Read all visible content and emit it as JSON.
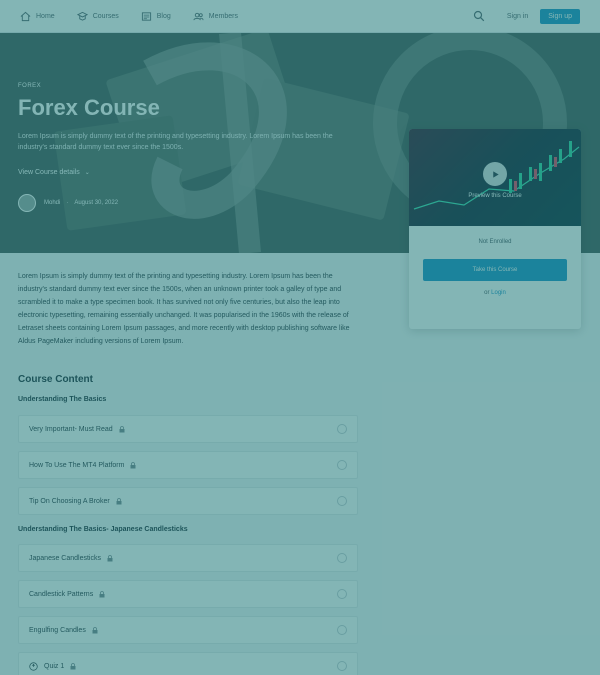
{
  "nav": {
    "items": [
      {
        "label": "Home",
        "icon": "home-icon"
      },
      {
        "label": "Courses",
        "icon": "courses-icon"
      },
      {
        "label": "Blog",
        "icon": "blog-icon"
      },
      {
        "label": "Members",
        "icon": "members-icon"
      }
    ],
    "signin": "Sign in",
    "signup": "Sign up"
  },
  "hero": {
    "tag": "FOREX",
    "title": "Forex Course",
    "description": "Lorem Ipsum is simply dummy text of the printing and typesetting industry. Lorem Ipsum has been the industry's standard dummy text ever since the 1500s.",
    "details_link": "View Course details",
    "author": "Mohdi",
    "date": "August 30, 2022"
  },
  "card": {
    "preview_label": "Preview this Course",
    "status": "Not Enrolled",
    "cta": "Take this Course",
    "or_text": "or",
    "login": "Login"
  },
  "about": "Lorem Ipsum is simply dummy text of the printing and typesetting industry. Lorem Ipsum has been the industry's standard dummy text ever since the 1500s, when an unknown printer took a galley of type and scrambled it to make a type specimen book. It has survived not only five centuries, but also the leap into electronic typesetting, remaining essentially unchanged. It was popularised in the 1960s with the release of Letraset sheets containing Lorem Ipsum passages, and more recently with desktop publishing software like Aldus PageMaker including versions of Lorem Ipsum.",
  "course_content": {
    "title": "Course Content",
    "topics": [
      {
        "title": "Understanding The Basics",
        "lessons": [
          "Very Important- Must Read",
          "How To Use The MT4 Platform",
          "Tip On Choosing A Broker"
        ]
      },
      {
        "title": "Understanding The Basics- Japanese Candlesticks",
        "lessons": [
          "Japanese Candlesticks",
          "Candlestick Patterns",
          "Engulfing Candles",
          "Quiz 1"
        ]
      }
    ]
  },
  "colors": {
    "accent": "#1a90c8"
  }
}
